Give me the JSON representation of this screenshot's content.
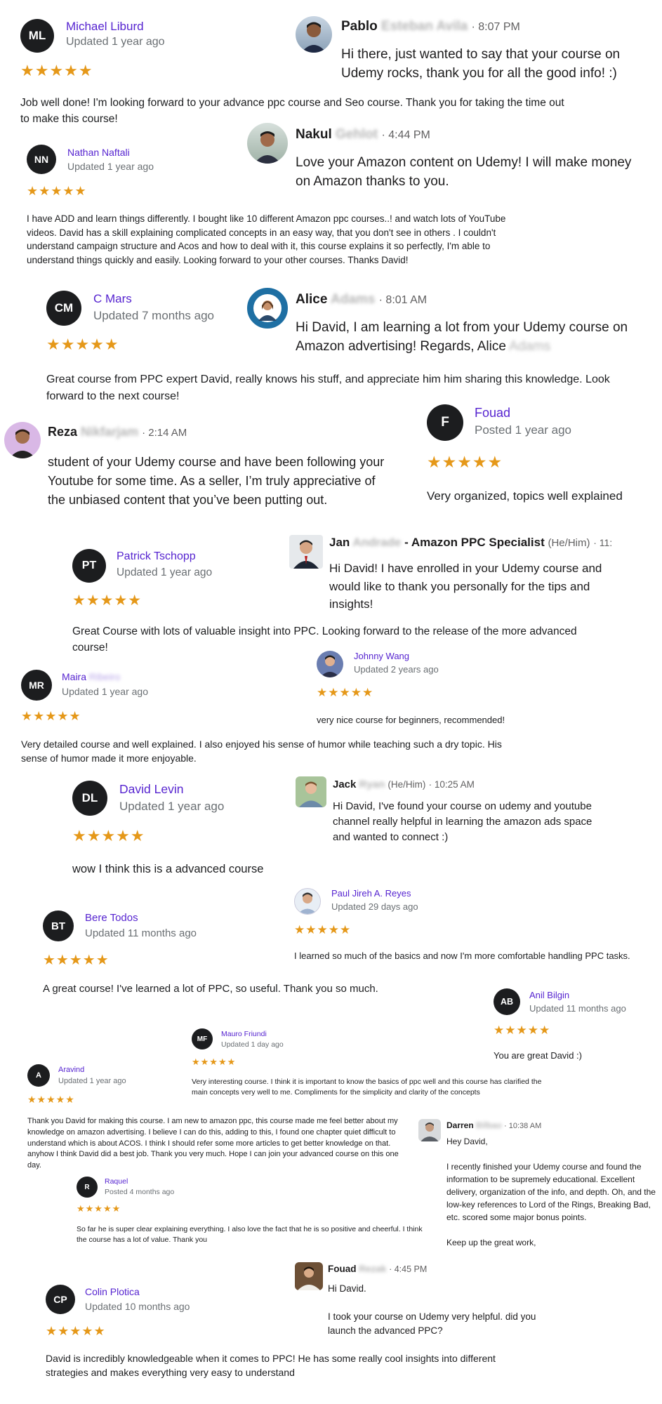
{
  "colors": {
    "accent": "#5624d0",
    "star": "#e59819",
    "avatar_bg": "#1c1d1f",
    "muted": "#6a6f73"
  },
  "stars_glyph": "★★★★★",
  "udemy": {
    "r1": {
      "initials": "ML",
      "name": "Michael Liburd",
      "meta": "Updated 1 year ago",
      "text": "Job well done! I'm looking forward to your advance ppc course and Seo course. Thank you for taking the time out to make this course!"
    },
    "r2": {
      "initials": "NN",
      "name": "Nathan Naftali",
      "meta": "Updated 1 year ago",
      "text": "I have ADD and learn things differently. I bought like 10 different Amazon ppc courses..! and watch lots of YouTube videos. David has a skill explaining complicated concepts in an easy way, that you don't see in others . I couldn't understand campaign structure and Acos and how to deal with it, this course explains it so perfectly, I'm able to understand things quickly and easily. Looking forward to your other courses. Thanks David!"
    },
    "r3": {
      "initials": "CM",
      "name": "C Mars",
      "meta": "Updated 7 months ago",
      "text": "Great course from PPC expert David, really knows his stuff, and appreciate him him sharing this knowledge. Look forward to the next course!"
    },
    "r4": {
      "initials": "F",
      "name": "Fouad",
      "meta": "Posted 1 year ago",
      "text": "Very organized, topics well explained"
    },
    "r5": {
      "initials": "PT",
      "name": "Patrick Tschopp",
      "meta": "Updated 1 year ago",
      "text": "Great Course with lots of valuable insight into PPC. Looking forward to the release of the more advanced course!"
    },
    "r6": {
      "initials": "MR",
      "name": "Maira",
      "name_blur": "Ribeiro",
      "meta": "Updated 1 year ago",
      "text": "Very detailed course and well explained. I also enjoyed his sense of humor while teaching such a dry topic. His sense of humor made it more enjoyable."
    },
    "r7": {
      "name": "Johnny Wang",
      "meta": "Updated 2 years ago",
      "text": "very nice course for beginners, recommended!"
    },
    "r8": {
      "initials": "DL",
      "name": "David Levin",
      "meta": "Updated 1 year ago",
      "text": "wow I think this is a advanced course"
    },
    "r9": {
      "name": "Paul Jireh A. Reyes",
      "meta": "Updated 29 days ago",
      "text": "I learned so much of the basics and now I'm more comfortable handling PPC tasks."
    },
    "r10": {
      "initials": "BT",
      "name": "Bere Todos",
      "meta": "Updated 11 months ago",
      "text": "A great course! I've learned a lot of PPC, so useful. Thank you so much."
    },
    "r11": {
      "initials": "AB",
      "name": "Anil Bilgin",
      "meta": "Updated 11 months ago",
      "text": "You are great David :)"
    },
    "r12": {
      "initials": "MF",
      "name": "Mauro Friundi",
      "meta": "Updated 1 day ago",
      "text": "Very interesting course. I think it is important to know the basics of ppc well and this course has clarified the main concepts very well to me. Compliments for the simplicity and clarity of the concepts"
    },
    "r13": {
      "initials": "A",
      "name": "Aravind",
      "meta": "Updated 1 year ago",
      "text": "Thank you David for making this course. I am new to amazon ppc, this course made me feel better about my knowledge on amazon advertising. I believe I can do this, adding to this, I found one chapter quiet difficult to understand which is about ACOS. I think I should refer some more articles to get better knowledge on that. anyhow I think David did a best job. Thank you very much. Hope I can join your advanced course on this one day."
    },
    "r14": {
      "initials": "R",
      "name": "Raquel",
      "meta": "Posted 4 months ago",
      "text": "So far he is super clear explaining everything. I also love the fact that he is so positive and cheerful. I think the course has a lot of value. Thank you"
    },
    "r15": {
      "initials": "CP",
      "name": "Colin Plotica",
      "meta": "Updated 10 months ago",
      "text": "David is incredibly knowledgeable when it comes to PPC! He has some really cool insights into different strategies and makes everything very easy to understand"
    }
  },
  "slack": {
    "s1": {
      "name": "Pablo",
      "name_blur": "Esteban Avila",
      "time": "· 8:07 PM",
      "message": "Hi there, just wanted to say that your course on Udemy rocks, thank you for all the good info! :)"
    },
    "s2": {
      "name": "Nakul",
      "name_blur": "Gehlot",
      "time": "· 4:44 PM",
      "message": "Love your Amazon content on Udemy! I will make money on Amazon thanks to you."
    },
    "s3": {
      "name": "Alice",
      "name_blur": "Adams",
      "time": "· 8:01 AM",
      "message": "Hi David, I am learning a lot from your Udemy course on Amazon advertising! Regards, Alice",
      "message_blur": "Adams"
    },
    "s4": {
      "name": "Reza",
      "name_blur": "Nikfarjam",
      "time": "· 2:14 AM",
      "message": "student of your Udemy course and have been following your Youtube for some time. As a seller, I’m truly appreciative of the unbiased content that you’ve been putting out."
    },
    "s5": {
      "name": "Jan",
      "name_blur": "Andrade",
      "suffix": "- Amazon PPC Specialist",
      "pronouns": "(He/Him)",
      "time": "· 11:",
      "message": "Hi David! I have enrolled in your Udemy course and would like to thank you personally for the tips and insights!"
    },
    "s6": {
      "name": "Jack",
      "name_blur": "Ryan",
      "pronouns": "(He/Him)",
      "time": "· 10:25 AM",
      "message": "Hi David, I've found your course on udemy and youtube channel really helpful in learning the amazon ads space and wanted to connect :)"
    },
    "s7": {
      "name": "Darren",
      "name_blur": "Bilbao",
      "time": "· 10:38 AM",
      "greeting": "Hey David,",
      "message": "I recently finished your Udemy course and found the information to be supremely educational. Excellent delivery, organization of the info, and depth. Oh, and the low-key references to Lord of the Rings, Breaking Bad, etc. scored some major bonus points.",
      "closing": "Keep up the great work,"
    },
    "s8": {
      "name": "Fouad",
      "name_blur": "Rezak",
      "time": "· 4:45 PM",
      "greeting": "Hi David.",
      "message": "I took your course on Udemy very helpful. did you launch the advanced PPC?"
    }
  }
}
